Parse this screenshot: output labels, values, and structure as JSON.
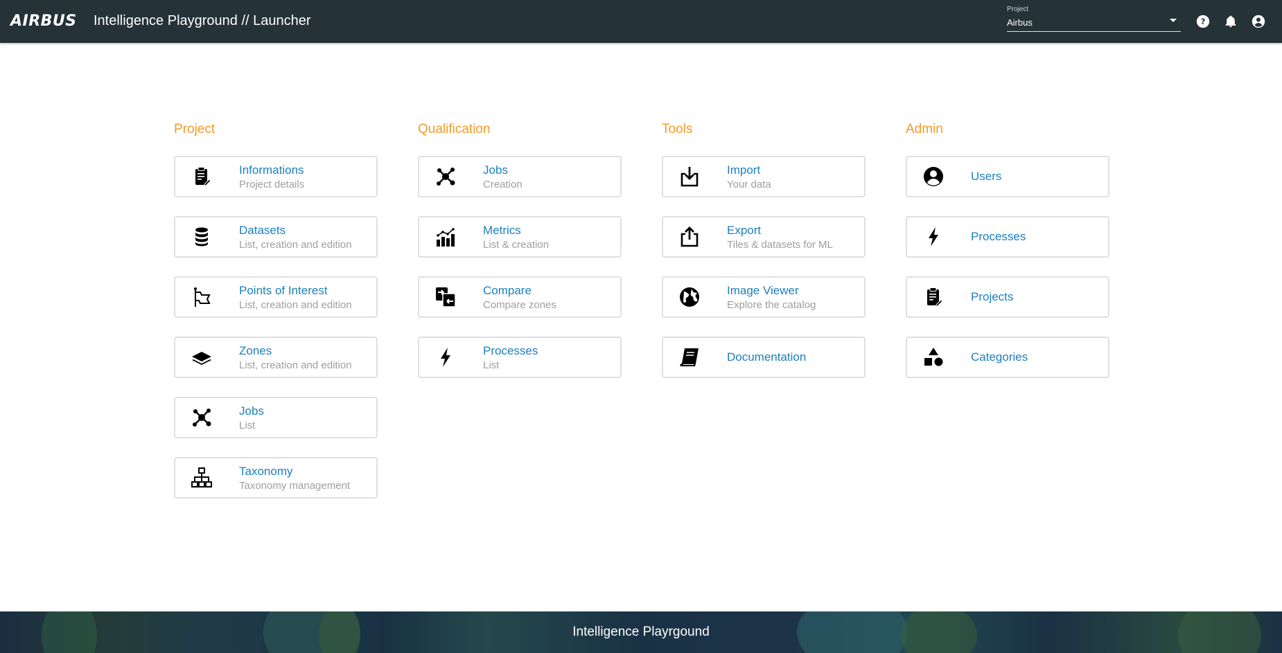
{
  "header": {
    "logo": "AIRBUS",
    "title": "Intelligence Playground // Launcher",
    "project_label": "Project",
    "project_value": "Airbus",
    "icons": [
      "help-icon",
      "bell-icon",
      "account-icon"
    ]
  },
  "columns": [
    {
      "title": "Project",
      "cards": [
        {
          "icon": "clipboard-icon",
          "title": "Informations",
          "sub": "Project details"
        },
        {
          "icon": "database-icon",
          "title": "Datasets",
          "sub": "List, creation and edition"
        },
        {
          "icon": "flag-icon",
          "title": "Points of Interest",
          "sub": "List, creation and edition"
        },
        {
          "icon": "layers-icon",
          "title": "Zones",
          "sub": "List, creation and edition"
        },
        {
          "icon": "network-icon",
          "title": "Jobs",
          "sub": "List"
        },
        {
          "icon": "sitemap-icon",
          "title": "Taxonomy",
          "sub": "Taxonomy management"
        }
      ]
    },
    {
      "title": "Qualification",
      "cards": [
        {
          "icon": "network-icon",
          "title": "Jobs",
          "sub": "Creation"
        },
        {
          "icon": "chart-icon",
          "title": "Metrics",
          "sub": "List & creation"
        },
        {
          "icon": "compare-icon",
          "title": "Compare",
          "sub": "Compare zones"
        },
        {
          "icon": "bolt-icon",
          "title": "Processes",
          "sub": "List"
        }
      ]
    },
    {
      "title": "Tools",
      "cards": [
        {
          "icon": "import-icon",
          "title": "Import",
          "sub": "Your data"
        },
        {
          "icon": "export-icon",
          "title": "Export",
          "sub": "Tiles & datasets for ML"
        },
        {
          "icon": "globe-icon",
          "title": "Image Viewer",
          "sub": "Explore the catalog"
        },
        {
          "icon": "book-icon",
          "title": "Documentation",
          "sub": ""
        }
      ]
    },
    {
      "title": "Admin",
      "cards": [
        {
          "icon": "user-icon",
          "title": "Users",
          "sub": ""
        },
        {
          "icon": "bolt-icon",
          "title": "Processes",
          "sub": ""
        },
        {
          "icon": "clipboard-icon",
          "title": "Projects",
          "sub": ""
        },
        {
          "icon": "shapes-icon",
          "title": "Categories",
          "sub": ""
        }
      ]
    }
  ],
  "footer": {
    "text": "Intelligence Playrgound"
  }
}
